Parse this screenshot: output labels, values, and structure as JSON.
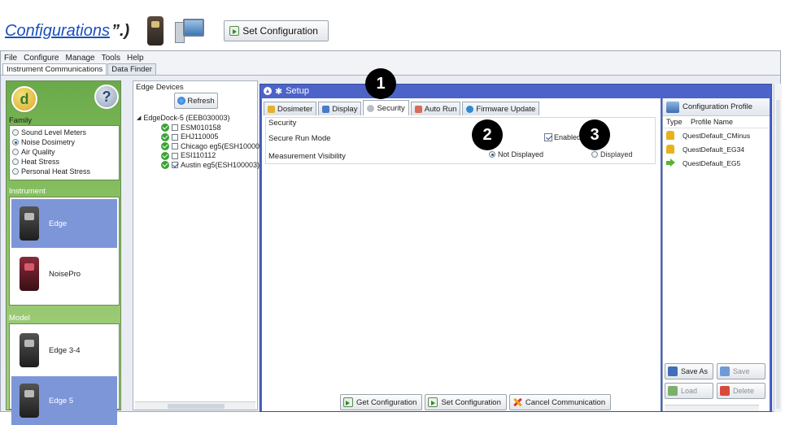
{
  "doc": {
    "link_text": "Configurations",
    "quote_tail": "”.)",
    "set_config_label": "Set Configuration"
  },
  "menubar": [
    "File",
    "Configure",
    "Manage",
    "Tools",
    "Help"
  ],
  "main_tabs": [
    "Instrument Communications",
    "Data Finder"
  ],
  "left": {
    "family_label": "Family",
    "family_options": [
      "Sound Level Meters",
      "Noise Dosimetry",
      "Air Quality",
      "Heat Stress",
      "Personal Heat Stress"
    ],
    "family_selected": "Noise Dosimetry",
    "instrument_label": "Instrument",
    "instruments": [
      "Edge",
      "NoisePro"
    ],
    "model_label": "Model",
    "models": [
      "Edge 3-4",
      "Edge 5"
    ]
  },
  "edge_devices": {
    "title": "Edge Devices",
    "refresh_label": "Refresh",
    "dock": "EdgeDock-5 (EEB030003)",
    "devices": [
      {
        "name": "ESM010158",
        "checked": false
      },
      {
        "name": "EHJ110005",
        "checked": false
      },
      {
        "name": "Chicago eg5(ESH100005",
        "checked": false
      },
      {
        "name": "ESI110112",
        "checked": false
      },
      {
        "name": "Austin eg5(ESH100003)",
        "checked": true
      }
    ]
  },
  "setup": {
    "title": "Setup",
    "tabs": [
      "Dosimeter",
      "Display",
      "Security",
      "Auto Run",
      "Firmware Update"
    ],
    "active_tab": "Security",
    "group_title": "Security",
    "secure_run_label": "Secure Run Mode",
    "enabled_label": "Enabled",
    "visibility_label": "Measurement Visibility",
    "not_displayed_label": "Not Displayed",
    "displayed_label": "Displayed",
    "get_config_label": "Get Configuration",
    "set_config_label": "Set Configuration",
    "cancel_label": "Cancel Communication"
  },
  "config_profile": {
    "title": "Configuration Profile",
    "col_type": "Type",
    "col_name": "Profile Name",
    "profiles": [
      "QuestDefault_CMinus",
      "QuestDefault_EG34",
      "QuestDefault_EG5"
    ],
    "save_as": "Save As",
    "save": "Save",
    "load": "Load",
    "delete": "Delete"
  },
  "callouts": [
    "1",
    "2",
    "3"
  ]
}
